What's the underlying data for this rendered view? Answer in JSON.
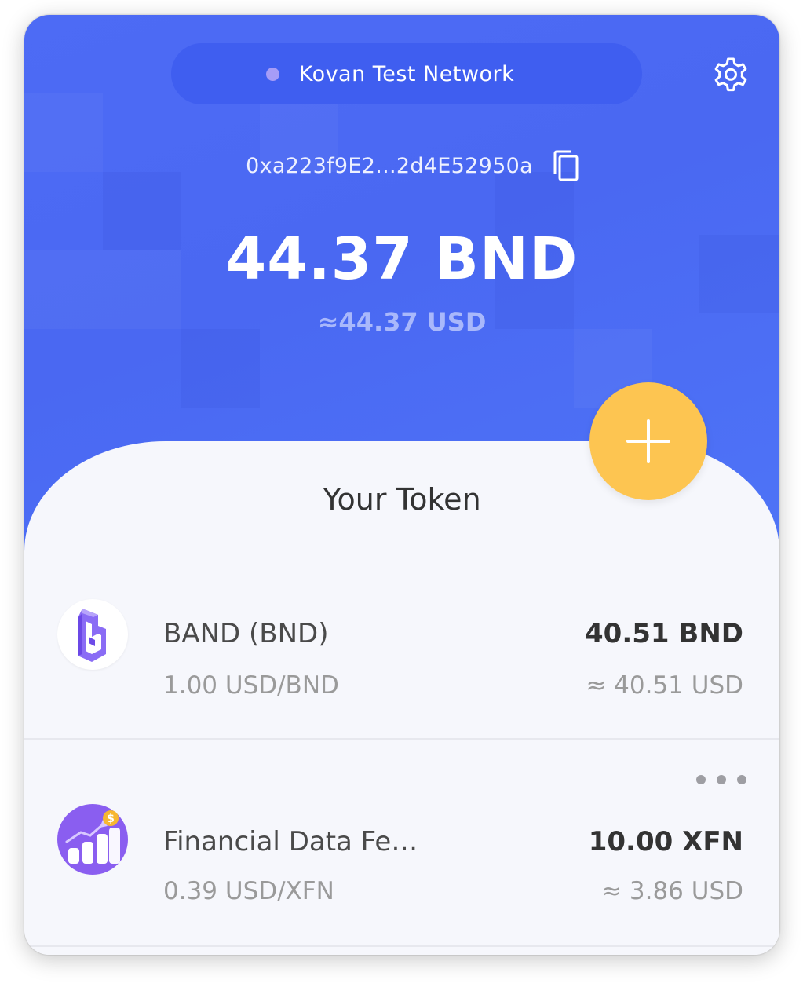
{
  "header": {
    "network": {
      "label": "Kovan Test Network",
      "status_color": "#a69cf7"
    },
    "settings_icon": "gear-icon",
    "address": "0xa223f9E2...2d4E52950a",
    "copy_icon": "copy-icon",
    "balance": "44.37 BND",
    "balance_usd": "≈44.37 USD"
  },
  "actions": {
    "add_icon": "plus-icon",
    "add_color": "#fdc551"
  },
  "tokens_section": {
    "title": "Your Token",
    "more_icon": "more-dots-icon",
    "items": [
      {
        "name": "BAND (BND)",
        "price": "1.00 USD/BND",
        "amount": "40.51 BND",
        "usd_value": "≈ 40.51 USD",
        "icon": "band-logo-icon"
      },
      {
        "name": "Financial Data Fe…",
        "price": "0.39 USD/XFN",
        "amount": "10.00 XFN",
        "usd_value": "≈ 3.86 USD",
        "icon": "financial-chart-icon"
      }
    ]
  },
  "colors": {
    "header_bg": "#4d6bf5",
    "pill_bg": "#3f5ef0",
    "accent": "#7b5cf0"
  }
}
